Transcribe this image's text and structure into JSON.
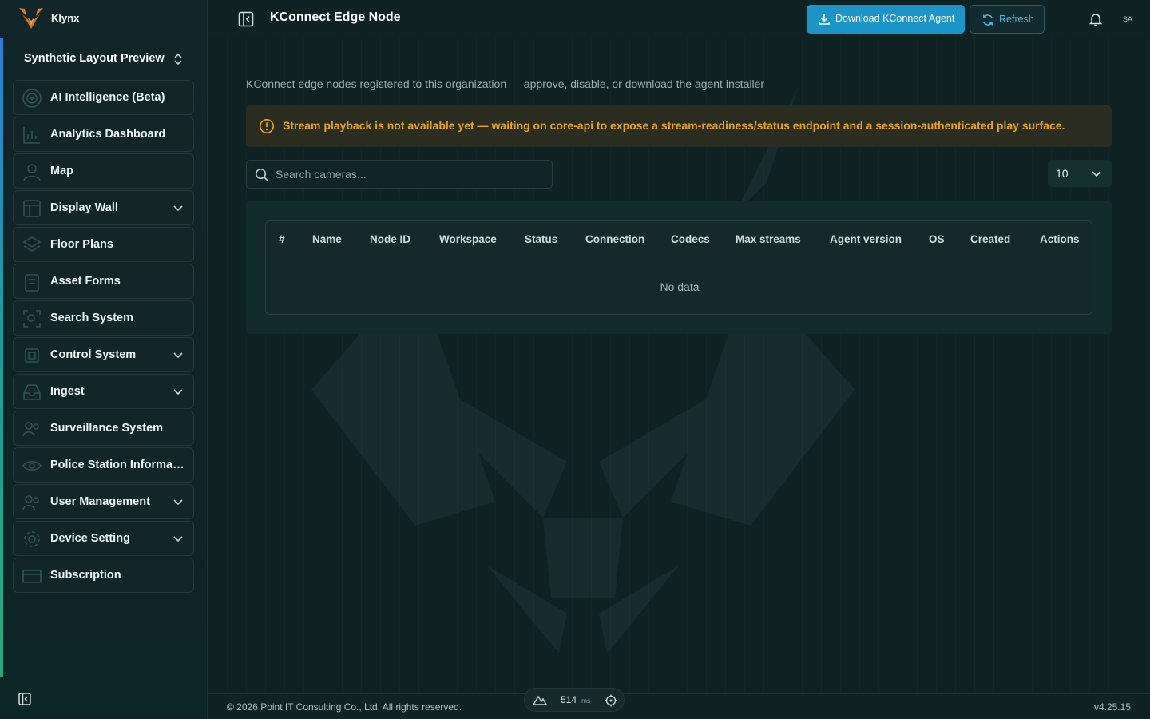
{
  "app": {
    "brand_name": "Klynx"
  },
  "sidebar": {
    "org_name": "Synthetic Layout Preview",
    "items": [
      {
        "label": "AI Intelligence (Beta)",
        "icon": "target-icon",
        "has_submenu": false
      },
      {
        "label": "Analytics Dashboard",
        "icon": "chart-icon",
        "has_submenu": false
      },
      {
        "label": "Map",
        "icon": "map-pin-icon",
        "has_submenu": false
      },
      {
        "label": "Display Wall",
        "icon": "layout-icon",
        "has_submenu": true
      },
      {
        "label": "Floor Plans",
        "icon": "layers-icon",
        "has_submenu": false
      },
      {
        "label": "Asset Forms",
        "icon": "clipboard-icon",
        "has_submenu": false
      },
      {
        "label": "Search System",
        "icon": "scan-search-icon",
        "has_submenu": false
      },
      {
        "label": "Control System",
        "icon": "chip-icon",
        "has_submenu": true
      },
      {
        "label": "Ingest",
        "icon": "inbox-icon",
        "has_submenu": true
      },
      {
        "label": "Surveillance System",
        "icon": "users-icon",
        "has_submenu": false
      },
      {
        "label": "Police Station Informati...",
        "icon": "eye-icon",
        "has_submenu": false
      },
      {
        "label": "User Management",
        "icon": "users-icon",
        "has_submenu": true
      },
      {
        "label": "Device Setting",
        "icon": "gear-icon",
        "has_submenu": true
      },
      {
        "label": "Subscription",
        "icon": "credit-card-icon",
        "has_submenu": false
      }
    ]
  },
  "header": {
    "title": "KConnect Edge Node",
    "download_label": "Download KConnect Agent",
    "refresh_label": "Refresh",
    "avatar_initials": "SA"
  },
  "main": {
    "description": "KConnect edge nodes registered to this organization — approve, disable, or download the agent installer",
    "warning": "Stream playback is not available yet — waiting on core-api to expose a stream-readiness/status endpoint and a session-authenticated play surface.",
    "search_placeholder": "Search cameras...",
    "page_size": "10",
    "table": {
      "columns": [
        "#",
        "Name",
        "Node ID",
        "Workspace",
        "Status",
        "Connection",
        "Codecs",
        "Max streams",
        "Agent version",
        "OS",
        "Created",
        "Actions"
      ],
      "rows": [],
      "empty_text": "No data"
    }
  },
  "footer": {
    "copyright": "© 2026 Point IT Consulting Co., Ltd. All rights reserved.",
    "version": "v4.25.15",
    "latency_value": "514",
    "latency_unit": "ms"
  },
  "colors": {
    "accent": "#1b94c8",
    "warning_text": "#e8a126",
    "warning_bg": "#2a2d20",
    "background": "#0e2224"
  }
}
